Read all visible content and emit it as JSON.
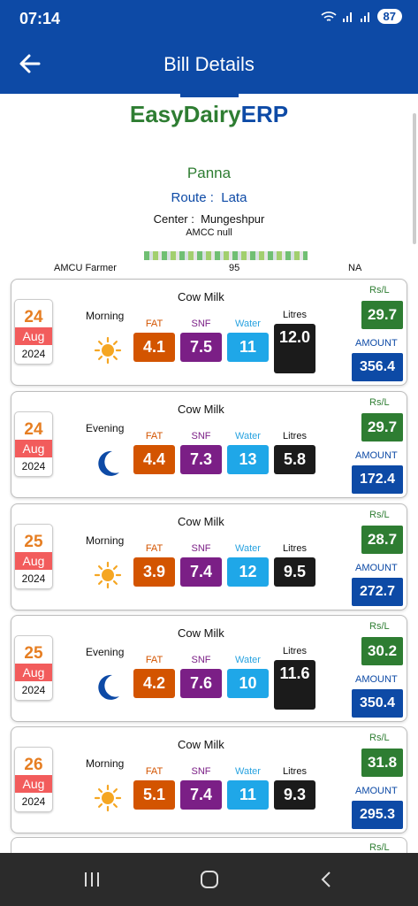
{
  "status": {
    "time": "07:14",
    "battery": "87"
  },
  "header": {
    "title": "Bill Details"
  },
  "logo": {
    "part1": "EasyDairy",
    "part2": "ERP"
  },
  "farmer": {
    "name": "Panna",
    "route_label": "Route :",
    "route": "Lata",
    "center_label": "Center :",
    "center": "Mungeshpur",
    "amcc": "AMCC  null",
    "type": "AMCU Farmer",
    "code": "95",
    "extra": "NA"
  },
  "labels": {
    "fat": "FAT",
    "snf": "SNF",
    "water": "Water",
    "litres": "Litres",
    "rsl": "Rs/L",
    "amount": "AMOUNT"
  },
  "colors": {
    "primary": "#0d4aa6",
    "green": "#2e7d32",
    "fat": "#d35400",
    "snf": "#7b1f86",
    "water": "#1fa7e8",
    "litres": "#1b1b1b",
    "date_red": "#f25c5c"
  },
  "entries": [
    {
      "day": "24",
      "month": "Aug",
      "year": "2024",
      "milk": "Cow Milk",
      "shift": "Morning",
      "icon": "sun-icon",
      "fat": "4.1",
      "snf": "7.5",
      "water": "11",
      "litres": "12.0",
      "rate": "29.7",
      "amount": "356.4"
    },
    {
      "day": "24",
      "month": "Aug",
      "year": "2024",
      "milk": "Cow Milk",
      "shift": "Evening",
      "icon": "moon-icon",
      "fat": "4.4",
      "snf": "7.3",
      "water": "13",
      "litres": "5.8",
      "rate": "29.7",
      "amount": "172.4"
    },
    {
      "day": "25",
      "month": "Aug",
      "year": "2024",
      "milk": "Cow Milk",
      "shift": "Morning",
      "icon": "sun-icon",
      "fat": "3.9",
      "snf": "7.4",
      "water": "12",
      "litres": "9.5",
      "rate": "28.7",
      "amount": "272.7"
    },
    {
      "day": "25",
      "month": "Aug",
      "year": "2024",
      "milk": "Cow Milk",
      "shift": "Evening",
      "icon": "moon-icon",
      "fat": "4.2",
      "snf": "7.6",
      "water": "10",
      "litres": "11.6",
      "rate": "30.2",
      "amount": "350.4"
    },
    {
      "day": "26",
      "month": "Aug",
      "year": "2024",
      "milk": "Cow Milk",
      "shift": "Morning",
      "icon": "sun-icon",
      "fat": "5.1",
      "snf": "7.4",
      "water": "11",
      "litres": "9.3",
      "rate": "31.8",
      "amount": "295.3"
    }
  ]
}
